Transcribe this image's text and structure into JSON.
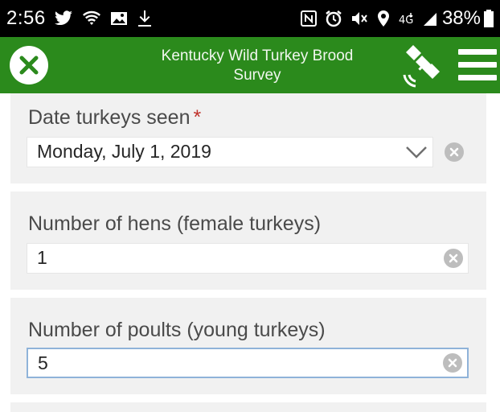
{
  "status_bar": {
    "time": "2:56",
    "battery": "38%",
    "icons": [
      "twitter-icon",
      "wifi-icon",
      "image-icon",
      "download-icon",
      "nfc-icon",
      "alarm-icon",
      "mute-icon",
      "location-icon",
      "4g-icon",
      "signal-icon",
      "battery-icon"
    ]
  },
  "app_bar": {
    "title": "Kentucky Wild Turkey Brood Survey",
    "color": "#2b8a1c"
  },
  "form": {
    "date": {
      "label": "Date turkeys seen",
      "required_mark": "*",
      "value": "Monday, July 1, 2019"
    },
    "hens": {
      "label": "Number of hens (female turkeys)",
      "value": "1"
    },
    "poults": {
      "label": "Number of poults (young turkeys)",
      "value": "5"
    }
  }
}
